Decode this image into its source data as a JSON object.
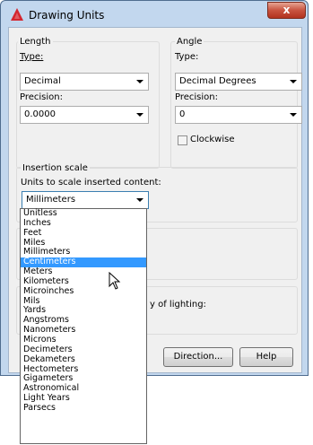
{
  "window": {
    "title": "Drawing Units",
    "close_label": "x"
  },
  "length": {
    "group_label": "Length",
    "type_label": "Type:",
    "type_value": "Decimal",
    "precision_label": "Precision:",
    "precision_value": "0.0000"
  },
  "angle": {
    "group_label": "Angle",
    "type_label": "Type:",
    "type_value": "Decimal Degrees",
    "precision_label": "Precision:",
    "precision_value": "0",
    "clockwise_label": "Clockwise",
    "clockwise_checked": false
  },
  "insertion": {
    "group_label": "Insertion scale",
    "units_label": "Units to scale inserted content:",
    "selected_value": "Millimeters"
  },
  "lighting": {
    "label_fragment": "y of lighting:"
  },
  "buttons": {
    "direction": "Direction...",
    "help": "Help"
  },
  "dropdown": {
    "options": [
      "Unitless",
      "Inches",
      "Feet",
      "Miles",
      "Millimeters",
      "Centimeters",
      "Meters",
      "Kilometers",
      "Microinches",
      "Mils",
      "Yards",
      "Angstroms",
      "Nanometers",
      "Microns",
      "Decimeters",
      "Dekameters",
      "Hectometers",
      "Gigameters",
      "Astronomical",
      "Light Years",
      "Parsecs"
    ],
    "highlighted_index": 5
  },
  "colors": {
    "highlight": "#3399ff",
    "titlebar": "#c2d7ee",
    "close_button": "#c8533f"
  }
}
